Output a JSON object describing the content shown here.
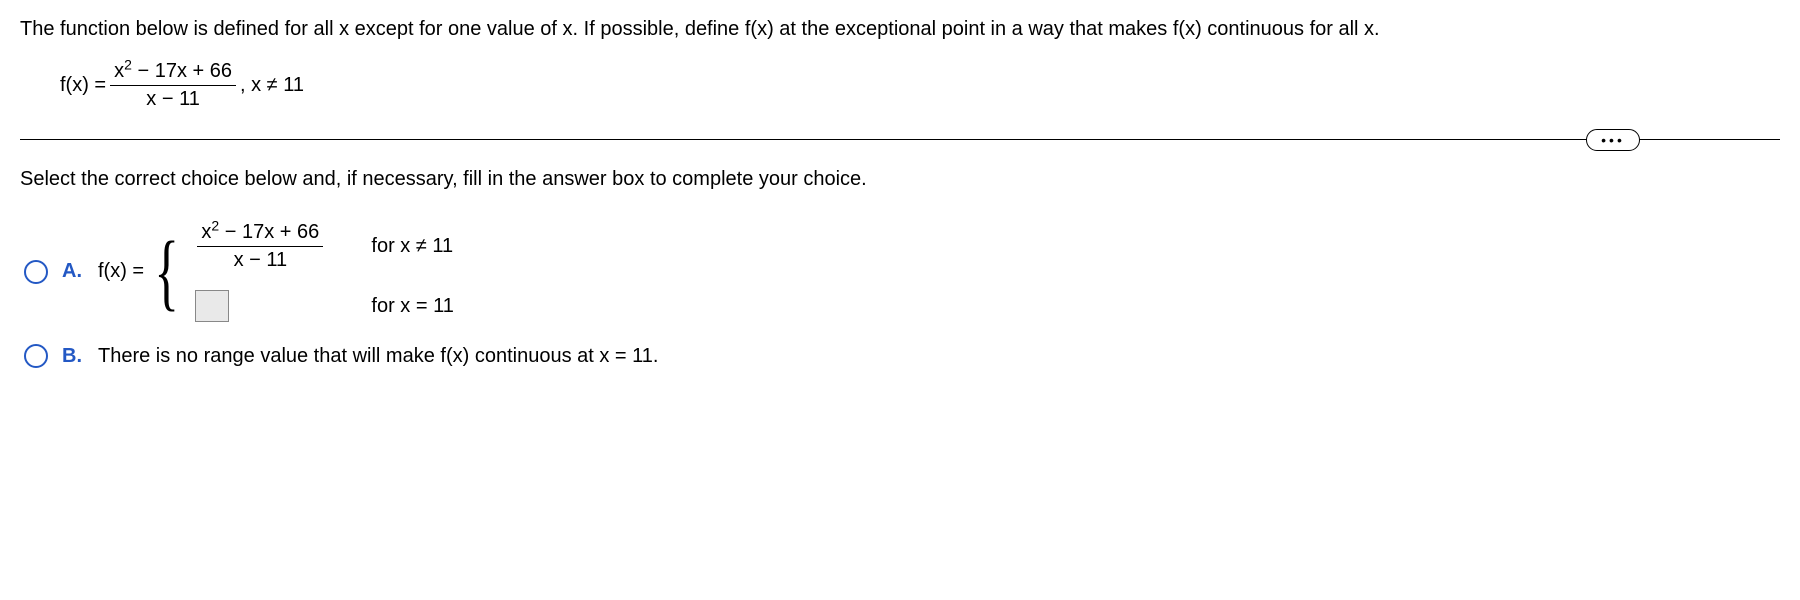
{
  "question": "The function below is defined for all x except for one value of x. If possible, define f(x) at the exceptional point in a way that makes f(x) continuous for all x.",
  "formula": {
    "lhs": "f(x) =",
    "numerator_pre": "x",
    "numerator_post": " − 17x + 66",
    "denominator": "x − 11",
    "condition": ", x ≠ 11"
  },
  "ellipsis": "•••",
  "instruction": "Select the correct choice below and, if necessary, fill in the answer box to complete your choice.",
  "choices": {
    "A": {
      "label": "A.",
      "lhs": "f(x) =",
      "case1_num_pre": "x",
      "case1_num_post": " − 17x + 66",
      "case1_den": "x − 11",
      "case1_cond": "for x ≠ 11",
      "case2_cond": "for x = 11"
    },
    "B": {
      "label": "B.",
      "text": "There is no range value that will make f(x) continuous at x = 11."
    }
  }
}
